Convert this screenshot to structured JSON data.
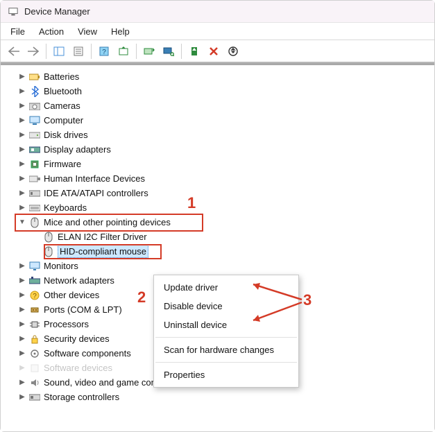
{
  "window": {
    "title": "Device Manager"
  },
  "menu": {
    "file": "File",
    "action": "Action",
    "view": "View",
    "help": "Help"
  },
  "tree": {
    "batteries": "Batteries",
    "bluetooth": "Bluetooth",
    "cameras": "Cameras",
    "computer": "Computer",
    "disk_drives": "Disk drives",
    "display_adapters": "Display adapters",
    "firmware": "Firmware",
    "hid": "Human Interface Devices",
    "ide": "IDE ATA/ATAPI controllers",
    "keyboards": "Keyboards",
    "mice": "Mice and other pointing devices",
    "mice_children": {
      "elan": "ELAN I2C Filter Driver",
      "hid_mouse": "HID-compliant mouse"
    },
    "monitors": "Monitors",
    "network": "Network adapters",
    "other": "Other devices",
    "ports": "Ports (COM & LPT)",
    "processors": "Processors",
    "security": "Security devices",
    "software_comp": "Software components",
    "sound": "Sound, video and game controllers",
    "storage": "Storage controllers"
  },
  "context_menu": {
    "update": "Update driver",
    "disable": "Disable device",
    "uninstall": "Uninstall device",
    "scan": "Scan for hardware changes",
    "properties": "Properties"
  },
  "annotations": {
    "one": "1",
    "two": "2",
    "three": "3"
  },
  "colors": {
    "highlight": "#d43b27",
    "selection": "#cde8ff"
  }
}
